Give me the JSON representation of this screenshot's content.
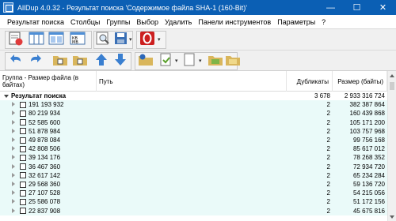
{
  "window": {
    "title": "AllDup 4.0.32 - Результат поиска 'Содержимое файла SHA-1 (160-Bit)'",
    "controls": [
      "minimize-icon",
      "maximize-icon",
      "close-icon"
    ]
  },
  "menu": [
    "Результат поиска",
    "Столбцы",
    "Группы",
    "Выбор",
    "Удалить",
    "Панели инструментов",
    "Параметры",
    "?"
  ],
  "toolbar": {
    "row1": [
      {
        "name": "close-result-icon",
        "color": "#e03c3c"
      },
      {
        "name": "columns-icon",
        "color": "#4f8fd6"
      },
      {
        "name": "groups-icon",
        "color": "#4f8fd6"
      },
      {
        "name": "size-units-icon",
        "color": "#4f8fd6"
      },
      {
        "name": "search-icon",
        "color": "#8a8a8a"
      },
      {
        "name": "save-icon",
        "color": "#3a6fb5"
      },
      {
        "name": "opera-icon",
        "color": "#cc1f1f"
      }
    ],
    "row2": [
      {
        "name": "undo-icon",
        "color": "#3a7fd0"
      },
      {
        "name": "redo-icon",
        "color": "#3a7fd0"
      },
      {
        "name": "folder-up-icon",
        "color": "#d9b65c"
      },
      {
        "name": "folder-down-icon",
        "color": "#d9b65c"
      },
      {
        "name": "arrow-up-icon",
        "color": "#3a7fd0"
      },
      {
        "name": "arrow-down-icon",
        "color": "#3a7fd0"
      },
      {
        "name": "settings-folder-icon",
        "color": "#d9b65c"
      },
      {
        "name": "select-check-icon",
        "color": "#5aa02c"
      },
      {
        "name": "select-blank-icon",
        "color": "#bbbbbb"
      },
      {
        "name": "folder-green-icon",
        "color": "#d9b65c"
      },
      {
        "name": "folder-yellow-icon",
        "color": "#d9b65c"
      }
    ]
  },
  "grid": {
    "headers": {
      "group": "Группа - Размер файла (в байтах)",
      "path": "Путь",
      "duplicates": "Дубликаты",
      "size": "Размер (байты)"
    },
    "root": {
      "label": "Результат поиска",
      "duplicates": "3 678",
      "size": "2 933 316 724"
    },
    "rows": [
      {
        "label": "191 193 932",
        "duplicates": "2",
        "size": "382 387 864"
      },
      {
        "label": "80 219 934",
        "duplicates": "2",
        "size": "160 439 868"
      },
      {
        "label": "52 585 600",
        "duplicates": "2",
        "size": "105 171 200"
      },
      {
        "label": "51 878 984",
        "duplicates": "2",
        "size": "103 757 968"
      },
      {
        "label": "49 878 084",
        "duplicates": "2",
        "size": "99 756 168"
      },
      {
        "label": "42 808 506",
        "duplicates": "2",
        "size": "85 617 012"
      },
      {
        "label": "39 134 176",
        "duplicates": "2",
        "size": "78 268 352"
      },
      {
        "label": "36 467 360",
        "duplicates": "2",
        "size": "72 934 720"
      },
      {
        "label": "32 617 142",
        "duplicates": "2",
        "size": "65 234 284"
      },
      {
        "label": "29 568 360",
        "duplicates": "2",
        "size": "59 136 720"
      },
      {
        "label": "27 107 528",
        "duplicates": "2",
        "size": "54 215 056"
      },
      {
        "label": "25 586 078",
        "duplicates": "2",
        "size": "51 172 156"
      },
      {
        "label": "22 837 908",
        "duplicates": "2",
        "size": "45 675 816"
      }
    ]
  }
}
